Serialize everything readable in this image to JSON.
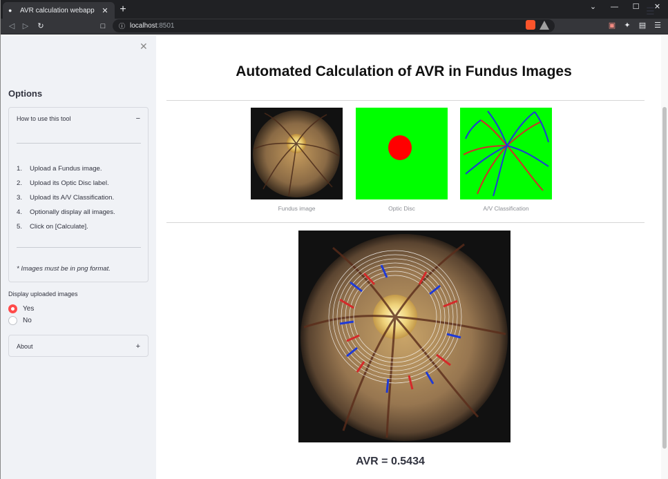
{
  "browser": {
    "tab_title": "AVR calculation webapp",
    "url_host": "localhost",
    "url_port": ":8501"
  },
  "sidebar": {
    "heading": "Options",
    "how_to": {
      "title": "How to use this tool",
      "toggle": "−",
      "steps": [
        {
          "num": "1.",
          "text": "Upload a Fundus image."
        },
        {
          "num": "2.",
          "text": "Upload its Optic Disc label."
        },
        {
          "num": "3.",
          "text": "Upload its A/V Classification."
        },
        {
          "num": "4.",
          "text": "Optionally display all images."
        },
        {
          "num": "5.",
          "text": "Click on [Calculate]."
        }
      ],
      "note": "* Images must be in png format."
    },
    "display_radio": {
      "label": "Display uploaded images",
      "options": [
        "Yes",
        "No"
      ],
      "selected": "Yes"
    },
    "about": {
      "title": "About",
      "toggle": "+"
    }
  },
  "main": {
    "title": "Automated Calculation of AVR in Fundus Images",
    "captions": [
      "Fundus image",
      "Optic Disc",
      "A/V Classification"
    ],
    "result": "AVR = 0.5434"
  },
  "colors": {
    "accent": "#ff4b4b",
    "sidebar_bg": "#f0f2f6",
    "label_green": "#00ff00",
    "label_red": "#ff0000",
    "artery_red": "#d42a2a",
    "vein_blue": "#1f3ad6"
  }
}
